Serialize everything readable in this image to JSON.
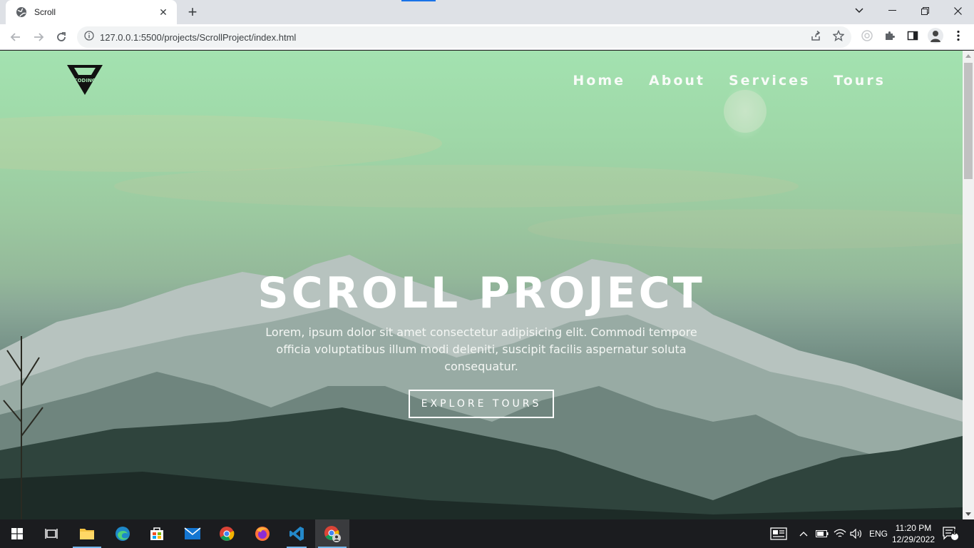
{
  "browser": {
    "tab_title": "Scroll",
    "url": "127.0.0.1:5500/projects/ScrollProject/index.html",
    "new_tab_label": "+",
    "close_tab_label": "✕"
  },
  "page": {
    "logo_text": "CODING",
    "nav": [
      {
        "label": "Home"
      },
      {
        "label": "About"
      },
      {
        "label": "Services"
      },
      {
        "label": "Tours"
      }
    ],
    "hero_title": "SCROLL PROJECT",
    "hero_text": "Lorem, ipsum dolor sit amet consectetur adipisicing elit. Commodi tempore officia voluptatibus illum modi deleniti, suscipit facilis aspernatur soluta consequatur.",
    "hero_button": "EXPLORE TOURS"
  },
  "taskbar": {
    "apps": [
      "start-icon",
      "task-view-icon",
      "file-explorer-icon",
      "edge-icon",
      "store-icon",
      "mail-icon",
      "chrome-icon",
      "firefox-icon",
      "vscode-icon",
      "chrome-profile-icon"
    ],
    "language": "ENG",
    "time": "11:20 PM",
    "date": "12/29/2022",
    "notification_count": "3"
  },
  "colors": {
    "accent": "#1a73e8",
    "hero_top": "#a3e2b0",
    "hero_bottom": "#1f2d29",
    "taskbar": "#1b1c1f"
  }
}
